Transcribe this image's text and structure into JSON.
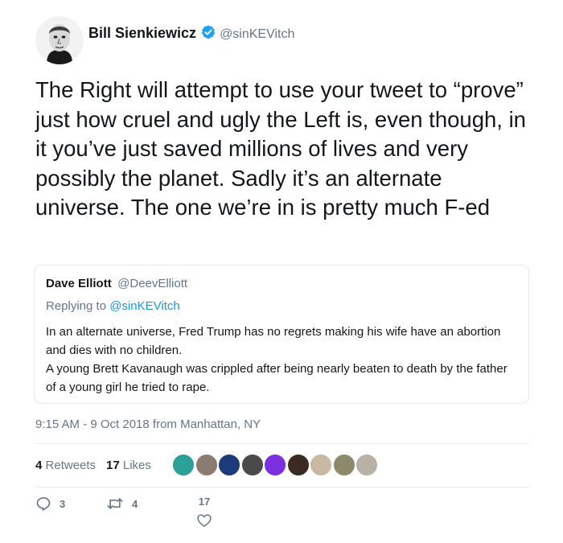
{
  "tweet": {
    "author": {
      "display_name": "Bill Sienkiewicz",
      "handle": "@sinKEVitch",
      "verified": true
    },
    "text": "The Right will attempt to use your tweet to “prove” just how cruel and ugly the Left is, even though, in it you’ve just saved millions of lives and very possibly the planet. Sadly it’s an alternate universe. The one we’re in is pretty much F-ed",
    "timestamp": "9:15 AM - 9 Oct 2018 from Manhattan, NY",
    "quoted": {
      "display_name": "Dave Elliott",
      "handle": "@DeevElliott",
      "replying_prefix": "Replying to ",
      "replying_to": "@sinKEVitch",
      "body_line_1": "In an alternate universe, Fred Trump has no regrets making his wife have an abortion and dies with no children.",
      "body_line_2": "A young Brett Kavanaugh was crippled after being nearly beaten to death by the father of a young girl he tried to rape."
    },
    "stats": {
      "retweets_count": "4",
      "retweets_label": "Retweets",
      "likes_count": "17",
      "likes_label": "Likes"
    },
    "liker_avatars": [
      "#2ba198",
      "#8a7c70",
      "#1d3a7a",
      "#4a4a4a",
      "#7b2fe0",
      "#3a2a22",
      "#c9b9a2",
      "#8c8a6a",
      "#b9b0a6"
    ],
    "actions": {
      "reply_count": "3",
      "retweet_count": "4",
      "like_count": "17"
    },
    "colors": {
      "link_blue": "#1b95e0",
      "verified_blue": "#1da1f2",
      "secondary_text": "#657786"
    }
  }
}
